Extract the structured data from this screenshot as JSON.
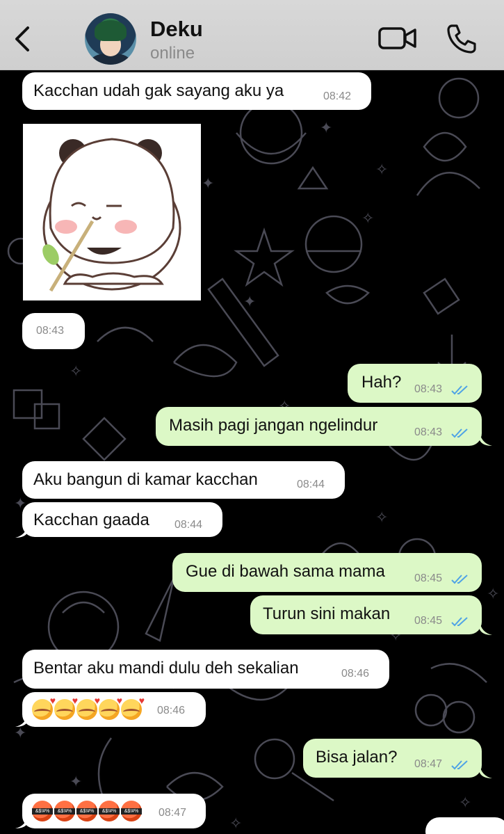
{
  "header": {
    "contact_name": "Deku",
    "status": "online",
    "back_icon": "chevron-left-icon",
    "video_icon": "video-camera-icon",
    "call_icon": "phone-icon"
  },
  "colors": {
    "incoming_bubble": "#ffffff",
    "outgoing_bubble": "#dcf8c6",
    "read_ticks": "#4fa3e6",
    "chat_background": "#000000",
    "doodle_lines": "#4a4a55"
  },
  "messages": [
    {
      "direction": "in",
      "text": "Kacchan udah gak sayang aku ya",
      "time": "08:42"
    },
    {
      "direction": "in",
      "type": "sticker",
      "sticker": "sad-panda-sticker",
      "time": "08:43"
    },
    {
      "direction": "out",
      "text": "Hah?",
      "time": "08:43",
      "read": true
    },
    {
      "direction": "out",
      "text": "Masih pagi jangan ngelindur",
      "time": "08:43",
      "read": true
    },
    {
      "direction": "in",
      "text": "Aku bangun di kamar kacchan",
      "time": "08:44"
    },
    {
      "direction": "in",
      "text": "Kacchan gaada",
      "time": "08:44"
    },
    {
      "direction": "out",
      "text": "Gue di bawah sama mama",
      "time": "08:45",
      "read": true
    },
    {
      "direction": "out",
      "text": "Turun sini makan",
      "time": "08:45",
      "read": true
    },
    {
      "direction": "in",
      "text": "Bentar aku mandi dulu deh sekalian",
      "time": "08:46"
    },
    {
      "direction": "in",
      "type": "emoji",
      "emoji": "smiling-face-with-hearts",
      "count": 5,
      "time": "08:46"
    },
    {
      "direction": "out",
      "text": "Bisa jalan?",
      "time": "08:47",
      "read": true
    },
    {
      "direction": "in",
      "type": "emoji",
      "emoji": "face-with-symbols-on-mouth",
      "count": 5,
      "time": "08:47"
    }
  ]
}
